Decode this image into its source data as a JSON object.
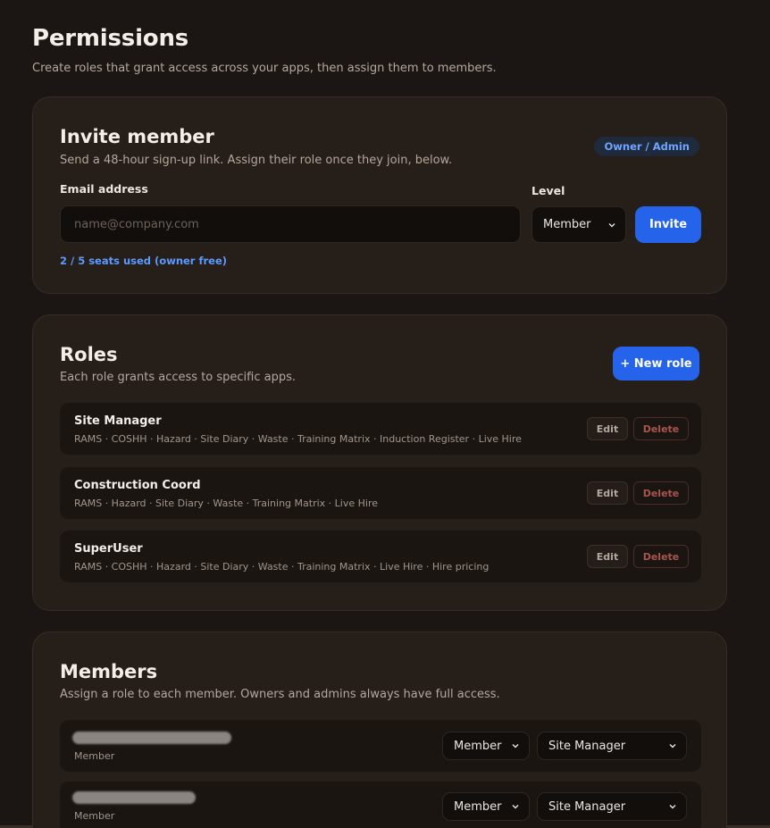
{
  "page": {
    "title": "Permissions",
    "subtitle": "Create roles that grant access across your apps, then assign them to members."
  },
  "invite": {
    "title": "Invite member",
    "subtitle": "Send a 48-hour sign-up link. Assign their role once they join, below.",
    "badge": "Owner / Admin",
    "email_label": "Email address",
    "email_placeholder": "name@company.com",
    "email_value": "",
    "level_label": "Level",
    "level_value": "Member",
    "invite_button": "Invite",
    "seats_text": "2 / 5 seats used (owner free)"
  },
  "roles": {
    "title": "Roles",
    "subtitle": "Each role grants access to specific apps.",
    "new_role_button": "+ New role",
    "edit_label": "Edit",
    "delete_label": "Delete",
    "items": [
      {
        "name": "Site Manager",
        "apps": "RAMS · COSHH · Hazard · Site Diary · Waste · Training Matrix · Induction Register · Live Hire"
      },
      {
        "name": "Construction Coord",
        "apps": "RAMS · Hazard · Site Diary · Waste · Training Matrix · Live Hire"
      },
      {
        "name": "SuperUser",
        "apps": "RAMS · COSHH · Hazard · Site Diary · Waste · Training Matrix · Live Hire · Hire pricing"
      }
    ]
  },
  "members": {
    "title": "Members",
    "subtitle": "Assign a role to each member. Owners and admins always have full access.",
    "items": [
      {
        "level_text": "Member",
        "level_select": "Member",
        "role_select": "Site Manager"
      },
      {
        "level_text": "Member",
        "level_select": "Member",
        "role_select": "Site Manager"
      }
    ]
  },
  "colors": {
    "background": "#1b1613",
    "card": "#261e19",
    "accent": "#2563eb",
    "badge_text": "#6fa4ff",
    "delete_text": "#a9554f"
  }
}
